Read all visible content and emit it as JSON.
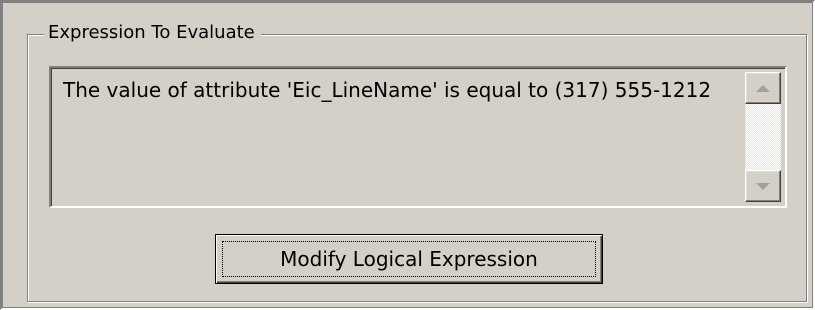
{
  "groupbox": {
    "title": "Expression To Evaluate"
  },
  "expression": {
    "text": "The value of attribute 'Eic_LineName' is equal to (317) 555-1212"
  },
  "scrollbar": {
    "up_icon": "scroll-up-arrow",
    "down_icon": "scroll-down-arrow",
    "enabled": false
  },
  "actions": {
    "modify_label": "Modify Logical Expression"
  }
}
